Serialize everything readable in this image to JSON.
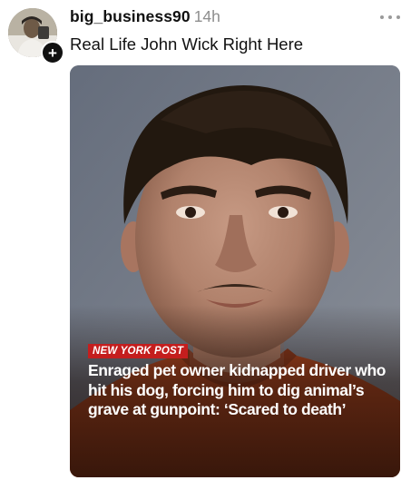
{
  "post": {
    "username": "big_business90",
    "timestamp": "14h",
    "caption": "Real Life John Wick Right Here",
    "follow_symbol": "+",
    "more_icon": "more-horizontal-icon"
  },
  "media": {
    "source_badge": "NEW YORK POST",
    "headline": "Enraged pet owner kidnapped driver who hit his dog, forcing him to dig animal’s grave at gunpoint: ‘Scared to death’"
  },
  "colors": {
    "badge_red": "#c41e1e",
    "timestamp_gray": "#8e8e8e",
    "shirt_orange": "#b54a22"
  }
}
